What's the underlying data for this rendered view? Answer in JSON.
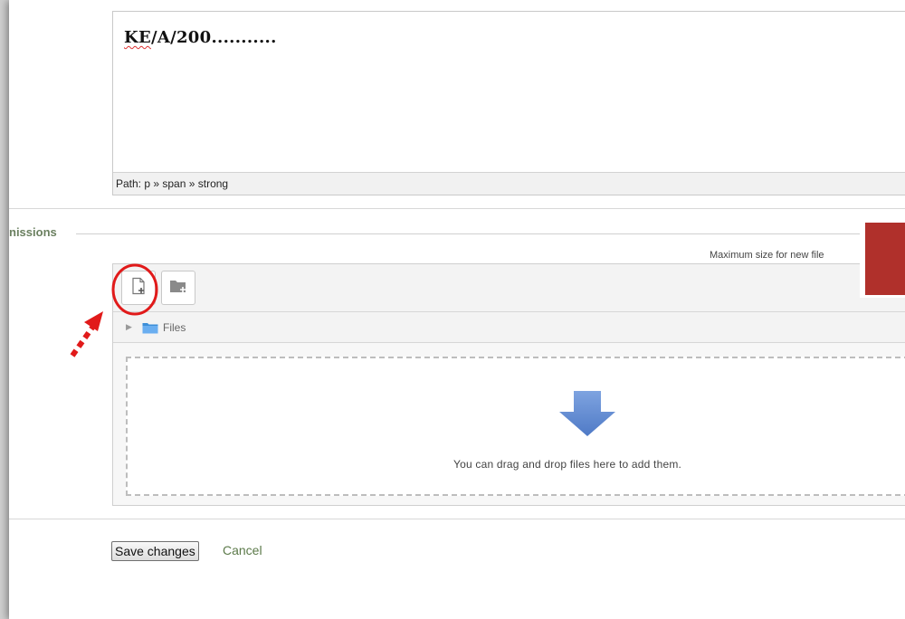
{
  "editor": {
    "text_prefix": "KE",
    "text_rest": "/A/200...........",
    "path_label": "Path: p » span » strong"
  },
  "section": {
    "legend": "nissions"
  },
  "filemanager": {
    "max_size_label": "Maximum size for new file",
    "add_file_icon": "file-add-icon",
    "create_folder_icon": "folder-add-icon",
    "path_label": "Files",
    "drop_text": "You can drag and drop files here to add them."
  },
  "actions": {
    "save_label": "Save changes",
    "cancel_label": "Cancel"
  },
  "colors": {
    "legend": "#6b8060",
    "cancel_link": "#5c7a4a",
    "annotation_red": "#e11a1a",
    "drop_arrow": "#5b86cf",
    "red_block": "#b0302b"
  }
}
